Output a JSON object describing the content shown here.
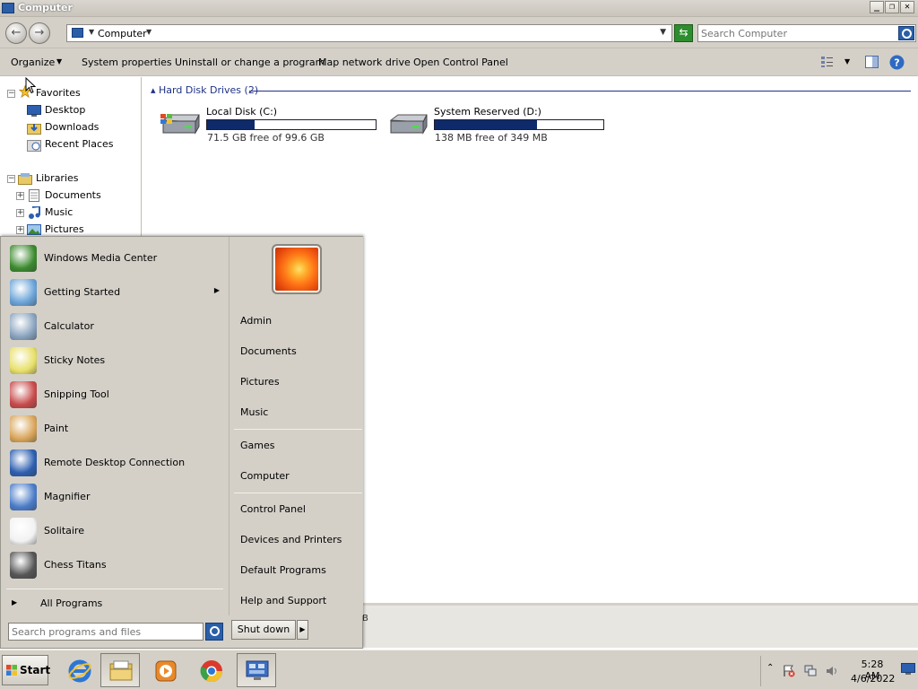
{
  "window": {
    "title": "Computer",
    "address": "Computer",
    "search_placeholder": "Search Computer"
  },
  "commandbar": {
    "items": [
      "Organize",
      "System properties",
      "Uninstall or change a program",
      "Map network drive",
      "Open Control Panel"
    ]
  },
  "navpane": {
    "favorites": "Favorites",
    "favorites_items": [
      "Desktop",
      "Downloads",
      "Recent Places"
    ],
    "libraries": "Libraries",
    "libraries_items": [
      "Documents",
      "Music",
      "Pictures"
    ]
  },
  "content": {
    "group_title": "Hard Disk Drives (2)",
    "drives": [
      {
        "name": "Local Disk (C:)",
        "free_text": "71.5 GB free of 99.6 GB",
        "used_fraction": 0.282
      },
      {
        "name": "System Reserved (D:)",
        "free_text": "138 MB free of 349 MB",
        "used_fraction": 0.605
      }
    ],
    "details_fragment": "B"
  },
  "startmenu": {
    "programs": [
      {
        "label": "Windows Media Center",
        "icon": "media-center-icon",
        "color": "#3c8a2e"
      },
      {
        "label": "Getting Started",
        "icon": "getting-started-icon",
        "color": "#6aa3d8",
        "submenu": "▶"
      },
      {
        "label": "Calculator",
        "icon": "calculator-icon",
        "color": "#8aa4bf"
      },
      {
        "label": "Sticky Notes",
        "icon": "sticky-notes-icon",
        "color": "#e8e06a"
      },
      {
        "label": "Snipping Tool",
        "icon": "snipping-tool-icon",
        "color": "#c84b4b"
      },
      {
        "label": "Paint",
        "icon": "paint-icon",
        "color": "#d9a55a"
      },
      {
        "label": "Remote Desktop Connection",
        "icon": "remote-desktop-icon",
        "color": "#2d5fb0"
      },
      {
        "label": "Magnifier",
        "icon": "magnifier-icon",
        "color": "#4b7cc8"
      },
      {
        "label": "Solitaire",
        "icon": "solitaire-icon",
        "color": "#f2f2f2"
      },
      {
        "label": "Chess Titans",
        "icon": "chess-titans-icon",
        "color": "#555555"
      }
    ],
    "all_programs": "All Programs",
    "right_links": {
      "group1": [
        "Admin",
        "Documents",
        "Pictures",
        "Music"
      ],
      "group2": [
        "Games",
        "Computer"
      ],
      "group3": [
        "Control Panel",
        "Devices and Printers",
        "Default Programs",
        "Help and Support"
      ]
    },
    "search_placeholder": "Search programs and files",
    "shutdown_label": "Shut down"
  },
  "taskbar": {
    "start_label": "Start",
    "pinned": [
      {
        "name": "internet-explorer-icon",
        "color": "#2b77d6"
      },
      {
        "name": "windows-explorer-icon",
        "color": "#e3c45a"
      },
      {
        "name": "media-player-icon",
        "color": "#e88a2a"
      },
      {
        "name": "chrome-icon",
        "color": "#d93a2b"
      },
      {
        "name": "remote-desktop-taskbar-icon",
        "color": "#3d6fc2"
      }
    ],
    "time": "5:28 AM",
    "date": "4/6/2022"
  },
  "colors": {
    "accent": "#1e3287",
    "drive_bar_fill": "#0f2a6b",
    "chrome": "#d4d0c8"
  }
}
